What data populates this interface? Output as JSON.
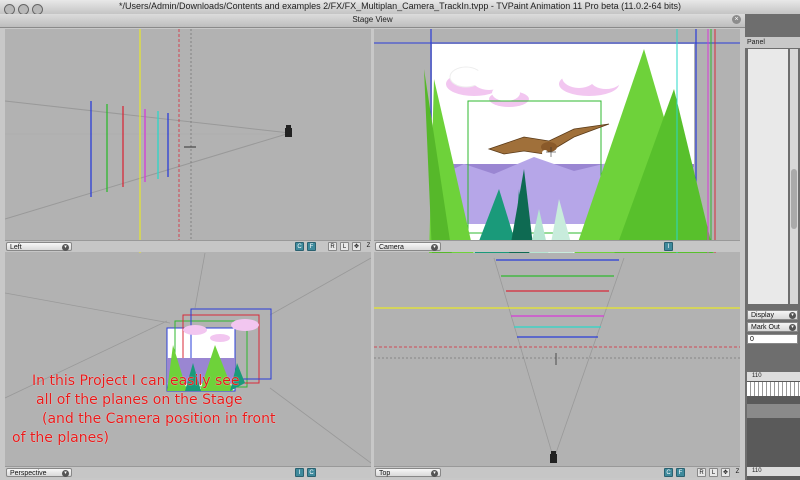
{
  "window": {
    "title": "*/Users/Admin/Downloads/Contents and examples 2/FX/FX_Multiplan_Camera_TrackIn.tvpp - TVPaint Animation 11 Pro beta (11.0.2-64 bits)"
  },
  "stage": {
    "title": "Stage View",
    "close_glyph": "×"
  },
  "panes": {
    "left": {
      "view": "Left",
      "buttons": [
        "C",
        "F"
      ],
      "tools": [
        "R",
        "L",
        "✥",
        "Z"
      ]
    },
    "camera": {
      "view": "Camera",
      "buttons": [
        "I"
      ]
    },
    "perspective": {
      "view": "Perspective",
      "buttons": [
        "I",
        "C"
      ]
    },
    "top": {
      "view": "Top",
      "buttons": [
        "C",
        "F"
      ],
      "tools": [
        "R",
        "L",
        "✥",
        "Z"
      ]
    }
  },
  "annotation": {
    "lines": [
      "In this Project I can easily see",
      "all of the planes on the Stage",
      "(and the Camera position in front",
      "of the planes)"
    ]
  },
  "side_panel": {
    "panel_label": "Panel",
    "display_label": "Display",
    "mark_out_label": "Mark Out",
    "mark_out_value": "0",
    "ruler_value": "110"
  },
  "colors": {
    "plane_blue": "#2a3cd8",
    "plane_green": "#2fb82f",
    "plane_red": "#d82a3a",
    "plane_magenta": "#d83ad8",
    "plane_cyan": "#2ad8c8",
    "guide_yellow": "#e8e82a",
    "sky": "#ffffff",
    "tree_green": "#6ed23a",
    "mountain_purple": "#9a86d2"
  }
}
